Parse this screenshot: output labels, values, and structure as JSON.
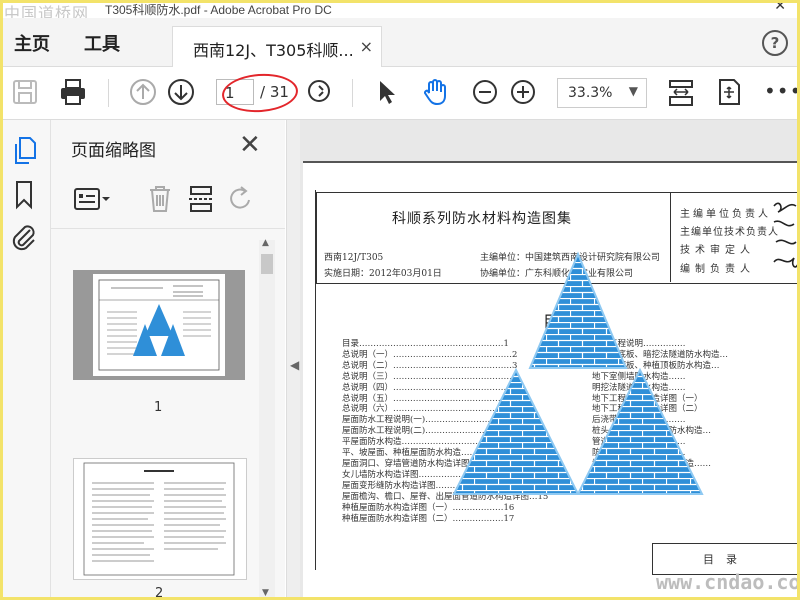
{
  "window": {
    "title": "T305科顺防水.pdf - Adobe Acrobat Pro DC",
    "watermark": "中国道桥网"
  },
  "menu": {
    "home": "主页",
    "tools": "工具"
  },
  "tab": {
    "label": "西南12J、T305科顺...",
    "close": "×"
  },
  "help": "?",
  "toolbar": {
    "current_page": "1",
    "total_pages": "/ 31",
    "zoom": "33.3%",
    "more": "•••"
  },
  "thumbnails": {
    "title": "页面缩略图",
    "close": "✕",
    "page1_label": "1",
    "page2_label": "2"
  },
  "document": {
    "title": "科顺系列防水材料构造图集",
    "code": "西南12J/T305",
    "date": "实施日期：2012年03月01日",
    "editor_unit": "主编单位：中国建筑西南设计研究院有限公司",
    "coop_unit": "协编单位：广东科顺化工实业有限公司",
    "sign_labels": [
      "主编单位负责人",
      "主编单位技术负责人",
      "技术审定人",
      "编制负责人"
    ],
    "toc_heading": "目录",
    "toc_left": [
      "目录……………………………………………1",
      "总说明（一）……………………………………2",
      "总说明（二）……………………………………3",
      "总说明（三）……………………………………4",
      "总说明（四）……………………………………5",
      "总说明（五）……………………………………6",
      "总说明（六）……………………………………7",
      "屋面防水工程说明(一)…………………………8",
      "屋面防水工程说明(二)…………………………9",
      "平屋面防水构造………………………………10",
      "平、坡屋面、种植屋面防水构造……………11",
      "屋面洞口、穿墙管道防水构造详图…………12",
      "女儿墙防水构造详图…………………………13",
      "屋面变形缝防水构造详图……………………14",
      "屋面檐沟、檐口、屋脊、出屋面管道防水构造详图…15",
      "种植屋面防水构造详图（一）………………16",
      "种植屋面防水构造详图（二）………………17"
    ],
    "toc_right": [
      "地下工程说明……………",
      "地下室底板、暗挖法隧道防水构造…",
      "地下室顶板、种植顶板防水构造…",
      "地下室侧墙防水构造……",
      "明挖法隧道防水构造……",
      "地下工程细部构造详图（一）",
      "地下工程细部构造详图（二）",
      "后浇带防水构造…………",
      "桩头、变形缝、附墙防水构造…",
      "管道穿墙防水构造………",
      "防水卷材搭接……………",
      "地面、楼面、墙体防水构造……"
    ],
    "bottom_label": "目录",
    "site_watermark": "www.cndao.com"
  },
  "colors": {
    "brick_blue": "#2f8fd8",
    "oval_red": "#e3262b",
    "frame_yellow": "#f3e36a"
  }
}
